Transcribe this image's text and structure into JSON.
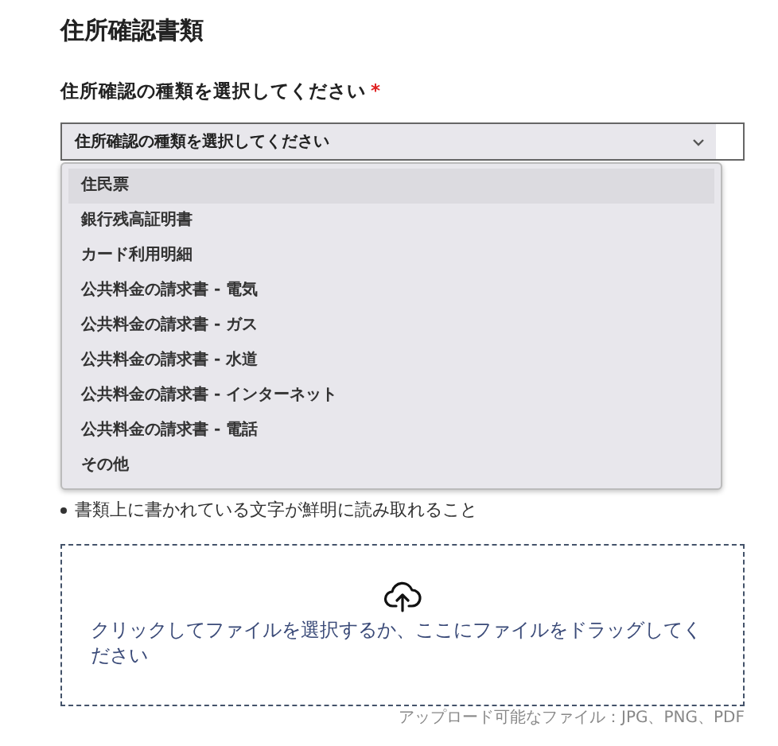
{
  "section_title": "住所確認書類",
  "field": {
    "label": "住所確認の種類を選択してください",
    "required_mark": "*",
    "placeholder": "住所確認の種類を選択してください",
    "expanded": true
  },
  "options": [
    {
      "label": "住民票",
      "selected": true
    },
    {
      "label": "銀行残高証明書",
      "selected": false
    },
    {
      "label": "カード利用明細",
      "selected": false
    },
    {
      "label": "公共料金の請求書 - 電気",
      "selected": false
    },
    {
      "label": "公共料金の請求書 - ガス",
      "selected": false
    },
    {
      "label": "公共料金の請求書 - 水道",
      "selected": false
    },
    {
      "label": "公共料金の請求書 - インターネット",
      "selected": false
    },
    {
      "label": "公共料金の請求書 - 電話",
      "selected": false
    },
    {
      "label": "その他",
      "selected": false
    }
  ],
  "requirements": [
    "書類上に書かれている文字が鮮明に読み取れること"
  ],
  "upload": {
    "prompt": "クリックしてファイルを選択するか、ここにファイルをドラッグしてください",
    "note": "アップロード可能なファイル：JPG、PNG、PDF"
  }
}
